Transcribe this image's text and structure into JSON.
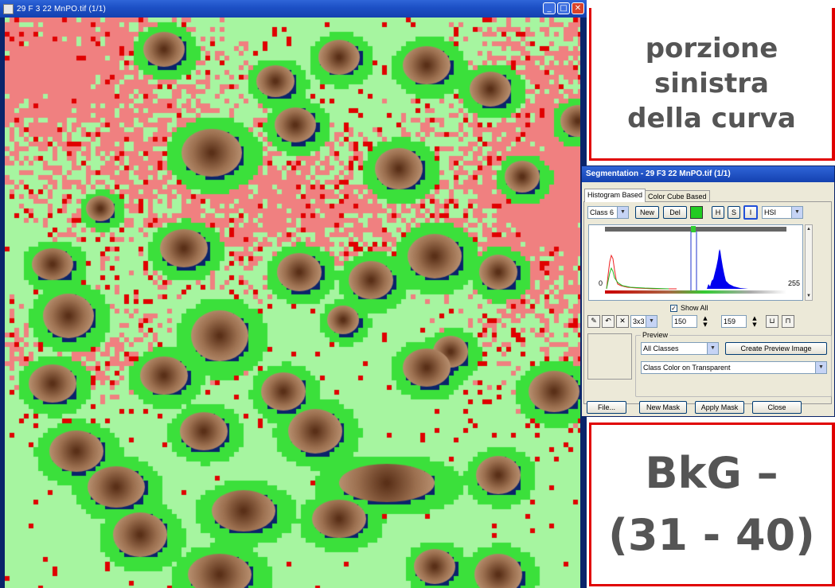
{
  "image_window": {
    "title": "29 F 3 22  MnPO.tif (1/1)",
    "buttons": {
      "minimize": "_",
      "maximize": "□",
      "close": "✕"
    }
  },
  "annotations": {
    "top_lines": [
      "porzione",
      "sinistra",
      "della curva"
    ],
    "bottom_lines": [
      "BkG –",
      "(31 - 40)"
    ]
  },
  "segmentation_dialog": {
    "title": "Segmentation - 29 F3 22  MnPO.tif (1/1)",
    "tabs": [
      "Histogram Based",
      "Color Cube Based"
    ],
    "class_select": "Class 6",
    "new_button": "New",
    "del_button": "Del",
    "class_color": "#22cc22",
    "channel_buttons": [
      "H",
      "S",
      "I"
    ],
    "color_space": "HSI",
    "axis_min": "0",
    "axis_max": "255",
    "show_all_label": "Show All",
    "show_all_checked": "✓",
    "kernel_select": "3x3",
    "range_low": "150",
    "range_high": "159",
    "preview_label": "Preview",
    "preview_classes": "All Classes",
    "create_preview_button": "Create Preview Image",
    "preview_mode": "Class Color on Transparent",
    "bottom_buttons": {
      "file": "File...",
      "new_mask": "New Mask",
      "apply_mask": "Apply Mask",
      "close": "Close"
    }
  },
  "colors": {
    "background_class": "#f08080",
    "threshold_class": "#e00000",
    "tissue_class": "#a6f5a0",
    "cell_halo": "#3be03b",
    "cell_body": "#9c7050",
    "box_border": "#e00000"
  }
}
